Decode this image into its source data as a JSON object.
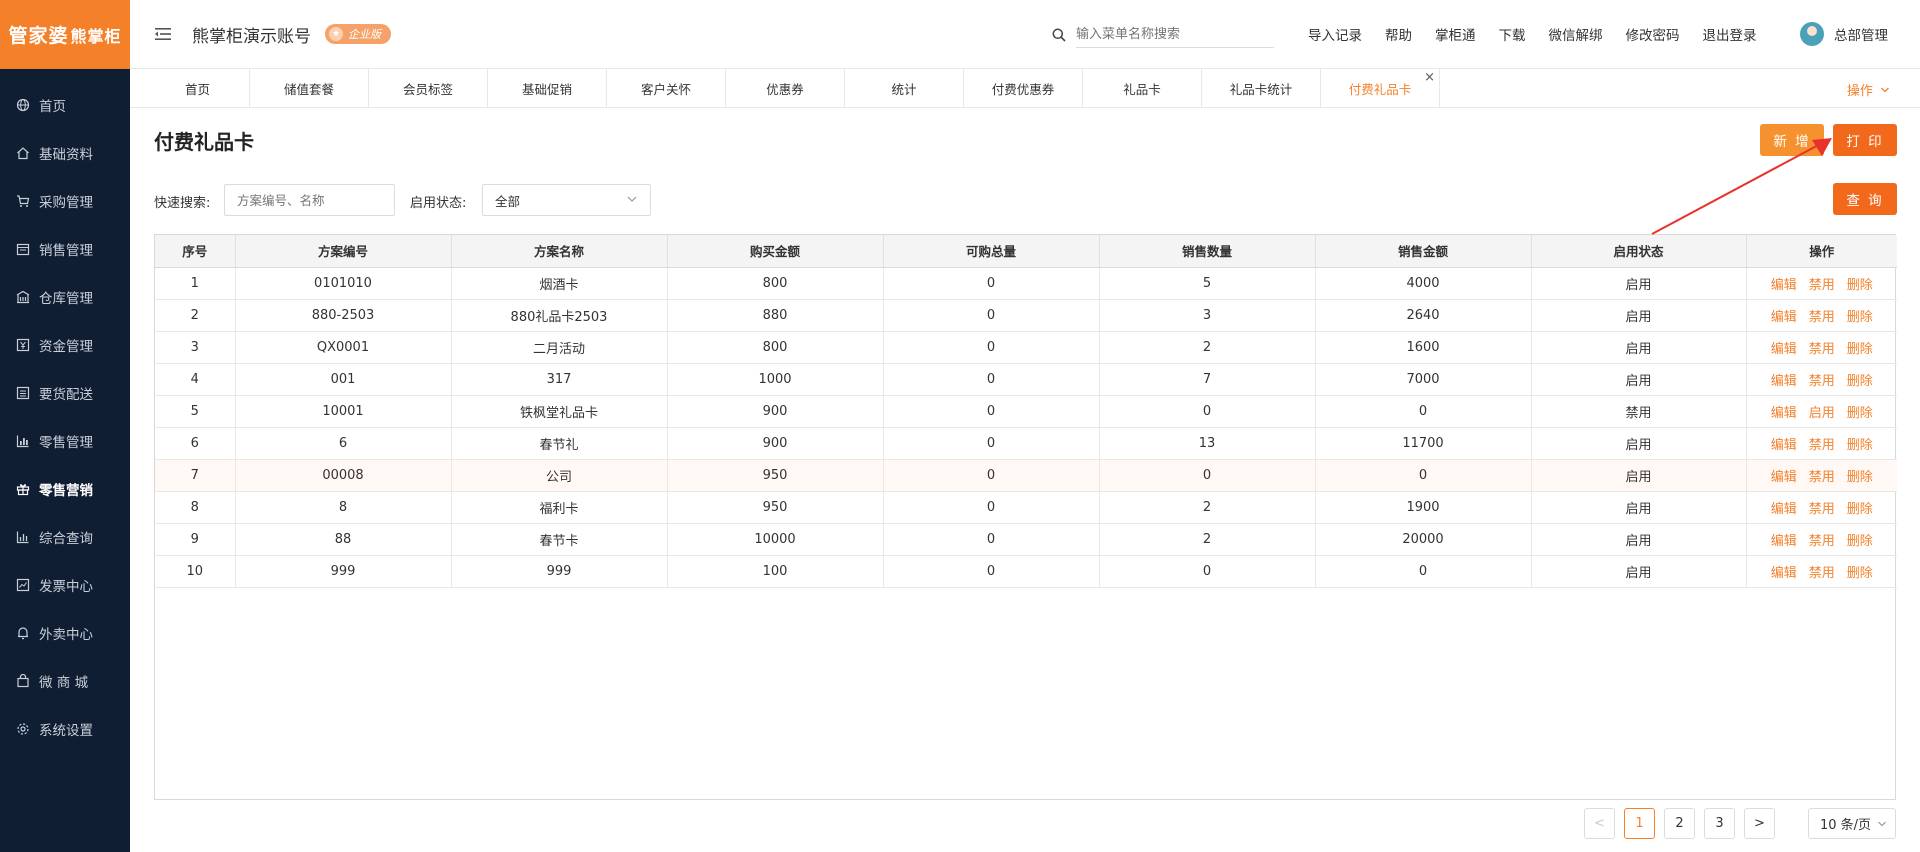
{
  "brand": {
    "logo_main": "管家婆",
    "logo_sub": "熊掌柜"
  },
  "sidebar": {
    "items": [
      {
        "label": "首页",
        "icon": "globe-icon"
      },
      {
        "label": "基础资料",
        "icon": "home-icon"
      },
      {
        "label": "采购管理",
        "icon": "cart-icon"
      },
      {
        "label": "销售管理",
        "icon": "calendar-icon"
      },
      {
        "label": "仓库管理",
        "icon": "warehouse-icon"
      },
      {
        "label": "资金管理",
        "icon": "money-icon"
      },
      {
        "label": "要货配送",
        "icon": "list-icon"
      },
      {
        "label": "零售管理",
        "icon": "chart-icon"
      },
      {
        "label": "零售营销",
        "icon": "gift-icon",
        "active": true
      },
      {
        "label": "综合查询",
        "icon": "bar-chart-icon"
      },
      {
        "label": "发票中心",
        "icon": "trend-icon"
      },
      {
        "label": "外卖中心",
        "icon": "bell-icon"
      },
      {
        "label": "微 商 城",
        "icon": "bag-icon"
      },
      {
        "label": "系统设置",
        "icon": "gear-icon"
      }
    ]
  },
  "header": {
    "account_name": "熊掌柜演示账号",
    "edition_badge": "企业版",
    "search_placeholder": "输入菜单名称搜索",
    "links": [
      "导入记录",
      "帮助",
      "掌柜通",
      "下载",
      "微信解绑",
      "修改密码",
      "退出登录"
    ],
    "user_name": "总部管理"
  },
  "tabs": {
    "items": [
      "首页",
      "储值套餐",
      "会员标签",
      "基础促销",
      "客户关怀",
      "优惠券",
      "统计",
      "付费优惠券",
      "礼品卡",
      "礼品卡统计",
      "付费礼品卡"
    ],
    "active_index": 10,
    "ops_label": "操作"
  },
  "page": {
    "title": "付费礼品卡",
    "new_button": "新 增",
    "print_button": "打 印",
    "query_button": "查 询"
  },
  "filters": {
    "quick_search_label": "快速搜索:",
    "quick_search_placeholder": "方案编号、名称",
    "status_label": "启用状态:",
    "status_value": "全部"
  },
  "table": {
    "columns": [
      "序号",
      "方案编号",
      "方案名称",
      "购买金额",
      "可购总量",
      "销售数量",
      "销售金额",
      "启用状态",
      "操作"
    ],
    "rows": [
      [
        "1",
        "0101010",
        "烟酒卡",
        "800",
        "0",
        "5",
        "4000",
        "启用",
        [
          "编辑",
          "禁用",
          "删除"
        ]
      ],
      [
        "2",
        "880-2503",
        "880礼品卡2503",
        "880",
        "0",
        "3",
        "2640",
        "启用",
        [
          "编辑",
          "禁用",
          "删除"
        ]
      ],
      [
        "3",
        "QX0001",
        "二月活动",
        "800",
        "0",
        "2",
        "1600",
        "启用",
        [
          "编辑",
          "禁用",
          "删除"
        ]
      ],
      [
        "4",
        "001",
        "317",
        "1000",
        "0",
        "7",
        "7000",
        "启用",
        [
          "编辑",
          "禁用",
          "删除"
        ]
      ],
      [
        "5",
        "10001",
        "铁枫堂礼品卡",
        "900",
        "0",
        "0",
        "0",
        "禁用",
        [
          "编辑",
          "启用",
          "删除"
        ]
      ],
      [
        "6",
        "6",
        "春节礼",
        "900",
        "0",
        "13",
        "11700",
        "启用",
        [
          "编辑",
          "禁用",
          "删除"
        ]
      ],
      [
        "7",
        "00008",
        "公司",
        "950",
        "0",
        "0",
        "0",
        "启用",
        [
          "编辑",
          "禁用",
          "删除"
        ]
      ],
      [
        "8",
        "8",
        "福利卡",
        "950",
        "0",
        "2",
        "1900",
        "启用",
        [
          "编辑",
          "禁用",
          "删除"
        ]
      ],
      [
        "9",
        "88",
        "春节卡",
        "10000",
        "0",
        "2",
        "20000",
        "启用",
        [
          "编辑",
          "禁用",
          "删除"
        ]
      ],
      [
        "10",
        "999",
        "999",
        "100",
        "0",
        "0",
        "0",
        "启用",
        [
          "编辑",
          "禁用",
          "删除"
        ]
      ]
    ],
    "highlight_row": 6
  },
  "pagination": {
    "prev": "<",
    "pages": [
      "1",
      "2",
      "3"
    ],
    "current": "1",
    "next": ">",
    "page_size": "10 条/页"
  },
  "colors": {
    "accent": "#f5802a",
    "sidebar_bg": "#0f1e33",
    "arrow": "#e8322d"
  }
}
